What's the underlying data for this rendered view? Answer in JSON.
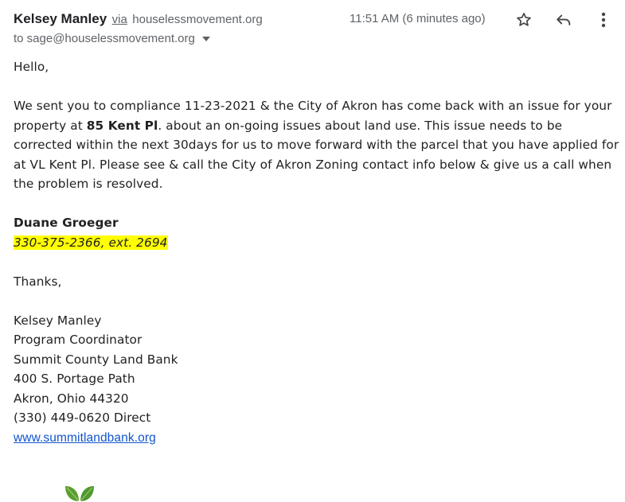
{
  "header": {
    "sender_name": "Kelsey Manley",
    "via_label": "via",
    "via_domain": "houselessmovement.org",
    "to_label": "to sage@houselessmovement.org",
    "time": "11:51 AM (6 minutes ago)",
    "icons": [
      "star-icon",
      "reply-icon",
      "more-vert-icon"
    ]
  },
  "body": {
    "greeting": "Hello,",
    "para_part1": "We sent you to compliance 11-23-2021 & the City of Akron has come back with an issue for your property at ",
    "property_bold": "85 Kent Pl",
    "para_part2": ". about an on-going issues about land use. This issue needs to be corrected within the next 30days for us to move forward with the parcel that you have applied for at VL Kent Pl. Please see & call the City of Akron Zoning contact info below & give us a call when the problem is resolved.",
    "contact_name": "Duane Groeger",
    "contact_phone": "330-375-2366, ext. 2694",
    "thanks": "Thanks,",
    "signature": {
      "name": "Kelsey Manley",
      "title": "Program Coordinator",
      "org": "Summit County Land Bank",
      "address1": "400 S. Portage Path",
      "address2": "Akron, Ohio 44320",
      "phone": "(330) 449-0620 Direct",
      "website": "www.summitlandbank.org"
    }
  },
  "colors": {
    "highlight": "#ffff00",
    "link": "#1155cc",
    "logo_leaf": "#5aa02c"
  }
}
